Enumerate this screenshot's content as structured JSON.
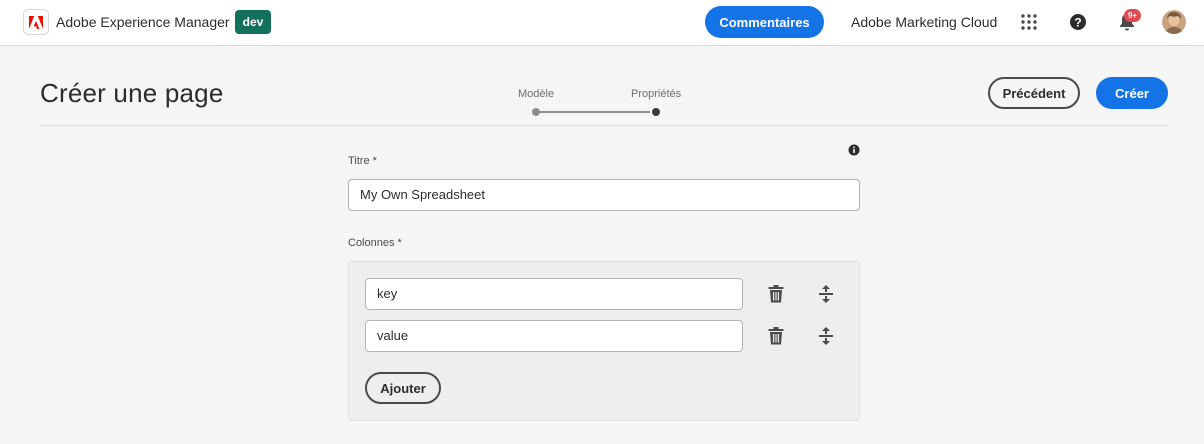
{
  "topbar": {
    "logo_icon": "adobe-logo-icon",
    "app_name": "Adobe Experience Manager",
    "env_badge": "dev",
    "feedback_label": "Commentaires",
    "marketing_cloud": "Adobe Marketing Cloud",
    "notifications_count": "9+",
    "icons": [
      "grid-icon",
      "help-icon",
      "bell-icon",
      "avatar"
    ]
  },
  "header": {
    "title": "Créer une page",
    "steps": [
      {
        "label": "Modèle",
        "state": "completed"
      },
      {
        "label": "Propriétés",
        "state": "current"
      }
    ],
    "prev_label": "Précédent",
    "create_label": "Créer"
  },
  "form": {
    "title_label": "Titre *",
    "title_value": "My Own Spreadsheet",
    "columns_label": "Colonnes *",
    "columns": [
      {
        "value": "key"
      },
      {
        "value": "value"
      }
    ],
    "add_label": "Ajouter"
  },
  "colors": {
    "accent": "#1473e6",
    "env_badge": "#12705b",
    "notification": "#e34850",
    "background": "#f5f5f5"
  }
}
